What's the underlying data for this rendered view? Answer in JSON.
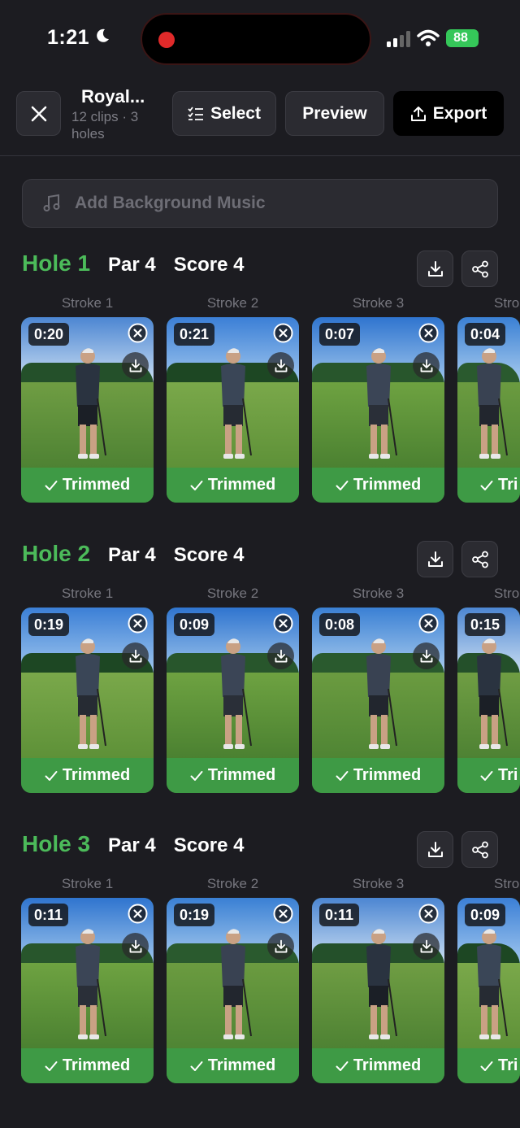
{
  "status_bar": {
    "time": "1:21",
    "battery": "88"
  },
  "header": {
    "title": "Royal...",
    "subtitle": "12 clips · 3 holes",
    "select_label": "Select",
    "preview_label": "Preview",
    "export_label": "Export"
  },
  "music": {
    "placeholder": "Add Background Music"
  },
  "holes": [
    {
      "name": "Hole 1",
      "par": "Par 4",
      "score": "Score 4",
      "clips": [
        {
          "stroke": "Stroke 1",
          "duration": "0:20",
          "status": "Trimmed"
        },
        {
          "stroke": "Stroke 2",
          "duration": "0:21",
          "status": "Trimmed"
        },
        {
          "stroke": "Stroke 3",
          "duration": "0:07",
          "status": "Trimmed"
        },
        {
          "stroke": "Stro",
          "duration": "0:04",
          "status": "Tri"
        }
      ]
    },
    {
      "name": "Hole 2",
      "par": "Par 4",
      "score": "Score 4",
      "clips": [
        {
          "stroke": "Stroke 1",
          "duration": "0:19",
          "status": "Trimmed"
        },
        {
          "stroke": "Stroke 2",
          "duration": "0:09",
          "status": "Trimmed"
        },
        {
          "stroke": "Stroke 3",
          "duration": "0:08",
          "status": "Trimmed"
        },
        {
          "stroke": "Stro",
          "duration": "0:15",
          "status": "Tri"
        }
      ]
    },
    {
      "name": "Hole 3",
      "par": "Par 4",
      "score": "Score 4",
      "clips": [
        {
          "stroke": "Stroke 1",
          "duration": "0:11",
          "status": "Trimmed"
        },
        {
          "stroke": "Stroke 2",
          "duration": "0:19",
          "status": "Trimmed"
        },
        {
          "stroke": "Stroke 3",
          "duration": "0:11",
          "status": "Trimmed"
        },
        {
          "stroke": "Stro",
          "duration": "0:09",
          "status": "Tri"
        }
      ]
    }
  ],
  "colors": {
    "accent_green": "#4cbb5a",
    "trimmed_green": "#3e9a45",
    "background": "#1c1c21"
  }
}
